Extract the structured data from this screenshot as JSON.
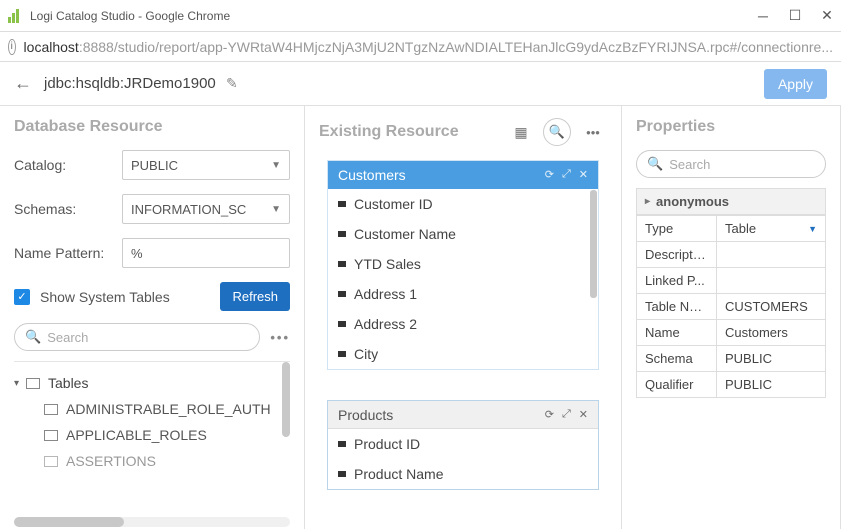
{
  "window": {
    "title": "Logi Catalog Studio - Google Chrome"
  },
  "addressbar": {
    "host": "localhost",
    "path": ":8888/studio/report/app-YWRtaW4HMjczNjA3MjU2NTgzNzAwNDIALTEHanJlcG9ydAczBzFYRIJNSA.rpc#/connectionre..."
  },
  "subheader": {
    "connection": "jdbc:hsqldb:JRDemo1900",
    "apply": "Apply"
  },
  "left": {
    "title": "Database Resource",
    "catalog_label": "Catalog:",
    "catalog_value": "PUBLIC",
    "schemas_label": "Schemas:",
    "schemas_value": "INFORMATION_SC",
    "name_pattern_label": "Name Pattern:",
    "name_pattern_value": "%",
    "show_system": "Show System Tables",
    "refresh": "Refresh",
    "search_placeholder": "Search",
    "tree_root": "Tables",
    "tree_items": [
      "ADMINISTRABLE_ROLE_AUTH",
      "APPLICABLE_ROLES",
      "ASSERTIONS"
    ]
  },
  "mid": {
    "title": "Existing Resource",
    "cards": [
      {
        "title": "Customers",
        "active": true,
        "fields": [
          "Customer ID",
          "Customer Name",
          "YTD Sales",
          "Address 1",
          "Address 2",
          "City"
        ]
      },
      {
        "title": "Products",
        "active": false,
        "fields": [
          "Product ID",
          "Product Name"
        ]
      }
    ]
  },
  "right": {
    "title": "Properties",
    "search_placeholder": "Search",
    "group": "anonymous",
    "rows": [
      {
        "k": "Type",
        "v": "Table",
        "select": true
      },
      {
        "k": "Description",
        "v": ""
      },
      {
        "k": "Linked P...",
        "v": ""
      },
      {
        "k": "Table Name",
        "v": "CUSTOMERS"
      },
      {
        "k": "Name",
        "v": "Customers"
      },
      {
        "k": "Schema",
        "v": "PUBLIC"
      },
      {
        "k": "Qualifier",
        "v": "PUBLIC"
      }
    ]
  }
}
